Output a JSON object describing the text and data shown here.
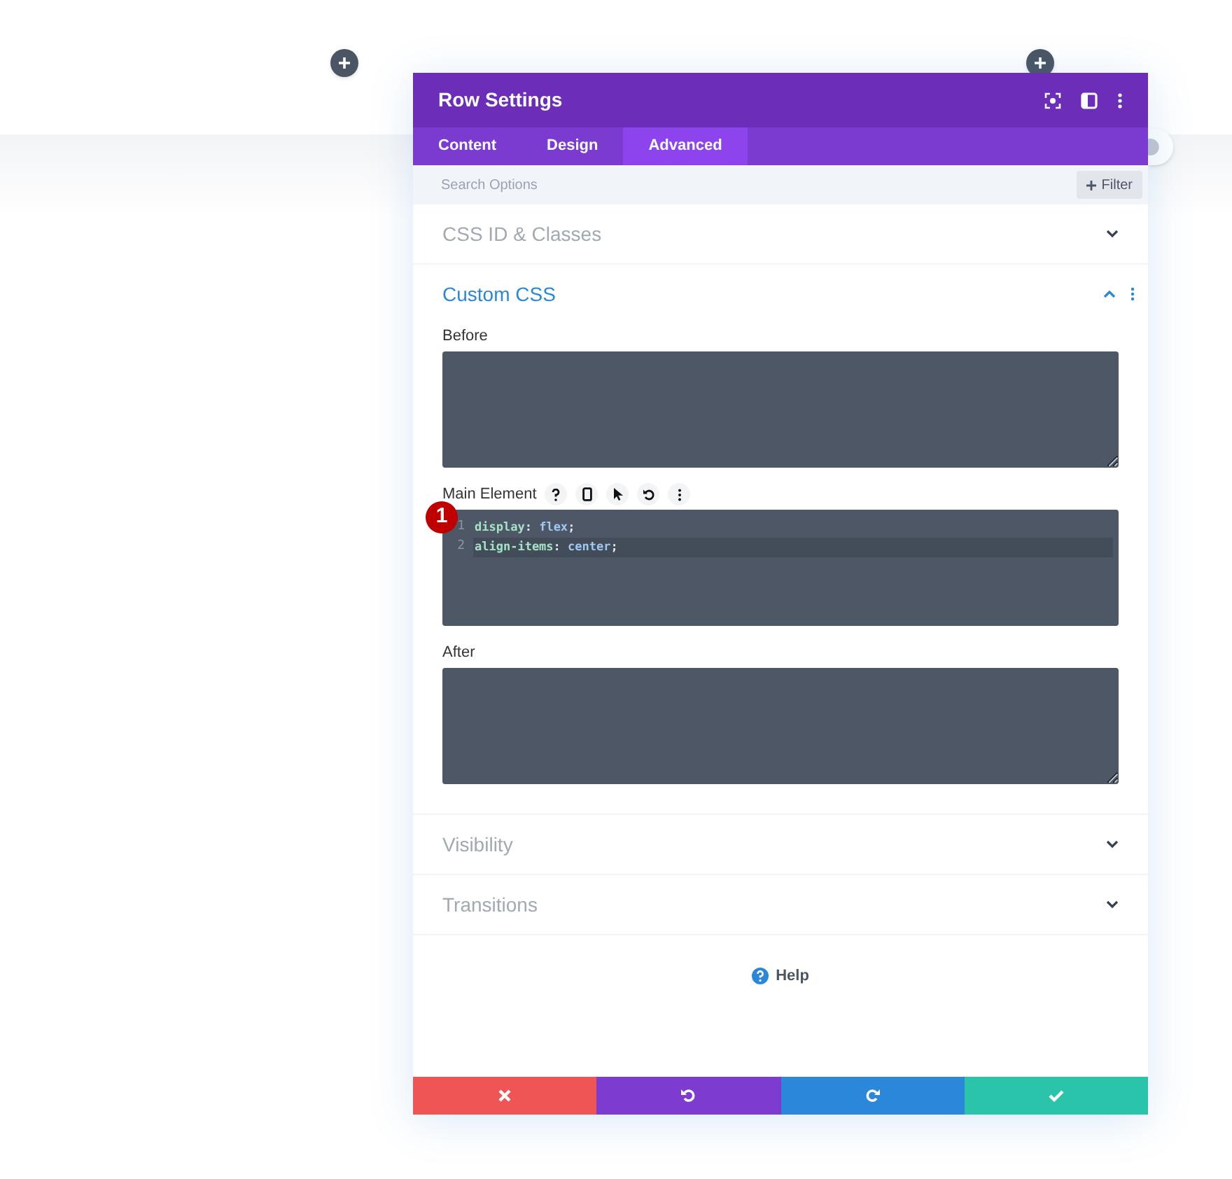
{
  "window": {
    "title": "Row Settings"
  },
  "tabs": [
    {
      "label": "Content",
      "selected": false
    },
    {
      "label": "Design",
      "selected": false
    },
    {
      "label": "Advanced",
      "selected": true
    }
  ],
  "search": {
    "placeholder": "Search Options"
  },
  "filter_button": {
    "label": "Filter"
  },
  "sections": [
    {
      "title": "CSS ID & Classes",
      "expanded": false
    },
    {
      "title": "Custom CSS",
      "expanded": true,
      "fields": [
        {
          "label": "Before",
          "kind": "textarea"
        },
        {
          "label": "Main Element",
          "kind": "code",
          "badge": "1",
          "lines": [
            {
              "number": "1",
              "active": false,
              "tokens": [
                {
                  "text": "display",
                  "kind": "property"
                },
                {
                  "text": ": ",
                  "kind": "punct"
                },
                {
                  "text": "flex",
                  "kind": "value"
                },
                {
                  "text": ";",
                  "kind": "punct"
                }
              ]
            },
            {
              "number": "2",
              "active": true,
              "tokens": [
                {
                  "text": "align-items",
                  "kind": "property"
                },
                {
                  "text": ": ",
                  "kind": "punct"
                },
                {
                  "text": "center",
                  "kind": "value"
                },
                {
                  "text": ";",
                  "kind": "punct"
                }
              ]
            }
          ]
        },
        {
          "label": "After",
          "kind": "textarea"
        }
      ]
    },
    {
      "title": "Visibility",
      "expanded": false
    },
    {
      "title": "Transitions",
      "expanded": false
    }
  ],
  "help": {
    "label": "Help"
  },
  "footer_buttons": [
    {
      "kind": "cancel"
    },
    {
      "kind": "undo"
    },
    {
      "kind": "redo"
    },
    {
      "kind": "save"
    }
  ]
}
